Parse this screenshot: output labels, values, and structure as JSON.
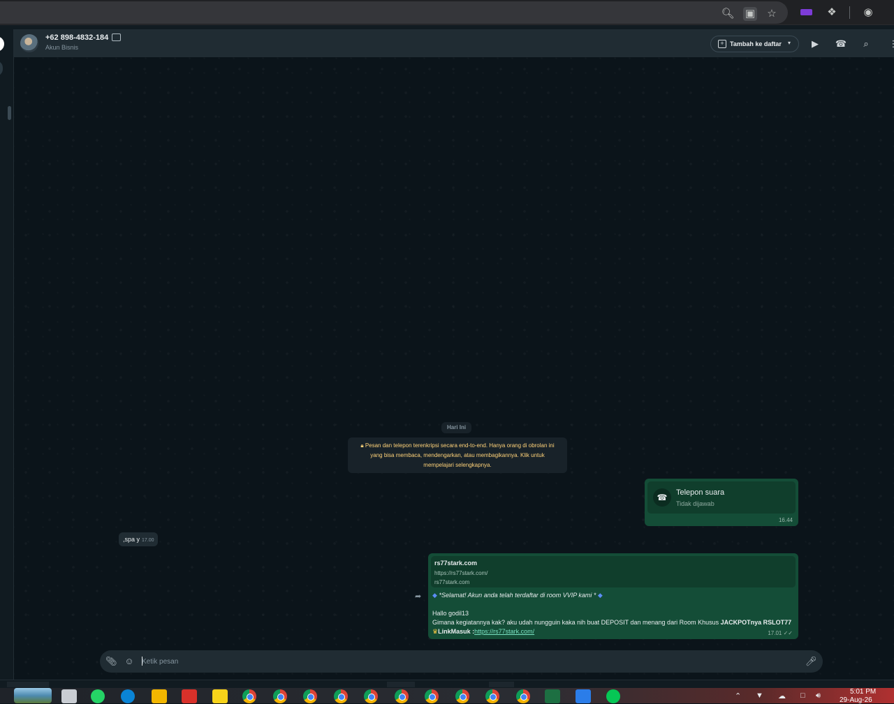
{
  "header": {
    "contact_name": "+62 898-4832-184",
    "contact_subtitle": "Akun Bisnis",
    "add_to_list_label": "Tambah ke daftar"
  },
  "chat": {
    "date_chip": "Hari Ini",
    "encryption_notice": "Pesan dan telepon terenkripsi secara end-to-end. Hanya orang di obrolan ini yang bisa membaca, mendengarkan, atau membagikannya. Klik untuk mempelajari selengkapnya.",
    "call": {
      "title": "Telepon suara",
      "status": "Tidak dijawab",
      "time": "16.44"
    },
    "incoming": {
      "text": ",spa y",
      "time": "17.00"
    },
    "link_message": {
      "preview_title": "rs77stark.com",
      "preview_url": "https://rs77stark.com/",
      "preview_domain": "rs77stark.com",
      "line1": "*Selamat! Akun anda telah terdaftar di room VVIP kami *",
      "line2": "Hallo godil13",
      "line3_prefix": "Gimana kegiatannya kak? aku udah nungguin kaka nih buat DEPOSIT dan menang dari Room Khusus ",
      "line3_bold": "JACKPOTnya RSLOT77",
      "line4_prefix": "LinkMasuk :",
      "line4_link": "https://rs77stark.com/",
      "time": "17.01"
    }
  },
  "composer": {
    "placeholder": "Ketik pesan"
  },
  "taskbar": {
    "time": "5:01 PM",
    "date": "29-Aug-26"
  },
  "colors": {
    "chat_bg": "#0b141a",
    "outgoing_bubble": "#144d37",
    "incoming_bubble": "#202c33",
    "notice_text": "#ffd279",
    "link": "#7ae3c3"
  },
  "icons": {
    "header": [
      "video-call-icon",
      "voice-call-icon",
      "search-icon",
      "menu-icon"
    ],
    "composer": [
      "attach-icon",
      "sticker-icon",
      "microphone-icon"
    ]
  }
}
